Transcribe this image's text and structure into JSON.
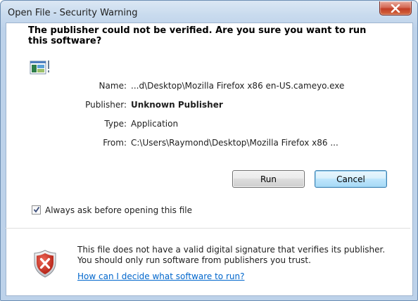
{
  "window": {
    "title": "Open File - Security Warning",
    "close_icon": "close-x-icon"
  },
  "headline": "The publisher could not be verified.  Are you sure you want to run this software?",
  "details": {
    "icon": "application-icon",
    "rows": [
      {
        "label": "Name:",
        "value": "...d\\Desktop\\Mozilla Firefox x86 en-US.cameyo.exe",
        "bold": false
      },
      {
        "label": "Publisher:",
        "value": "Unknown Publisher",
        "bold": true
      },
      {
        "label": "Type:",
        "value": "Application",
        "bold": false
      },
      {
        "label": "From:",
        "value": "C:\\Users\\Raymond\\Desktop\\Mozilla Firefox x86 ...",
        "bold": false
      }
    ]
  },
  "buttons": {
    "run_label": "Run",
    "cancel_label": "Cancel"
  },
  "checkbox": {
    "label": "Always ask before opening this file",
    "checked": true
  },
  "warning": {
    "icon": "security-shield-error-icon",
    "text": "This file does not have a valid digital signature that verifies its publisher.  You should only run software from publishers you trust.",
    "link_text": "How can I decide what software to run?"
  },
  "colors": {
    "link": "#0066cc",
    "close_button": "#c23e26",
    "shield_red": "#c62828"
  }
}
